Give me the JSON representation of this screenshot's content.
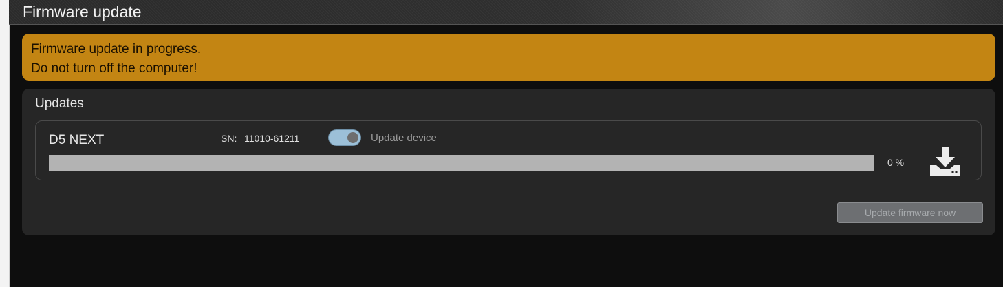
{
  "window": {
    "title": "Firmware update"
  },
  "warning": {
    "line1": "Firmware update in progress.",
    "line2": "Do not turn off the computer!",
    "color": "#c38513"
  },
  "updates": {
    "title": "Updates",
    "devices": [
      {
        "name": "D5 NEXT",
        "sn_label": "SN:",
        "sn_value": "11010-61211",
        "toggle": {
          "state": "on",
          "label": "Update device"
        },
        "progress": {
          "value": 0,
          "text": "0 %"
        },
        "icon": "download-icon"
      }
    ],
    "button_label": "Update firmware now"
  }
}
